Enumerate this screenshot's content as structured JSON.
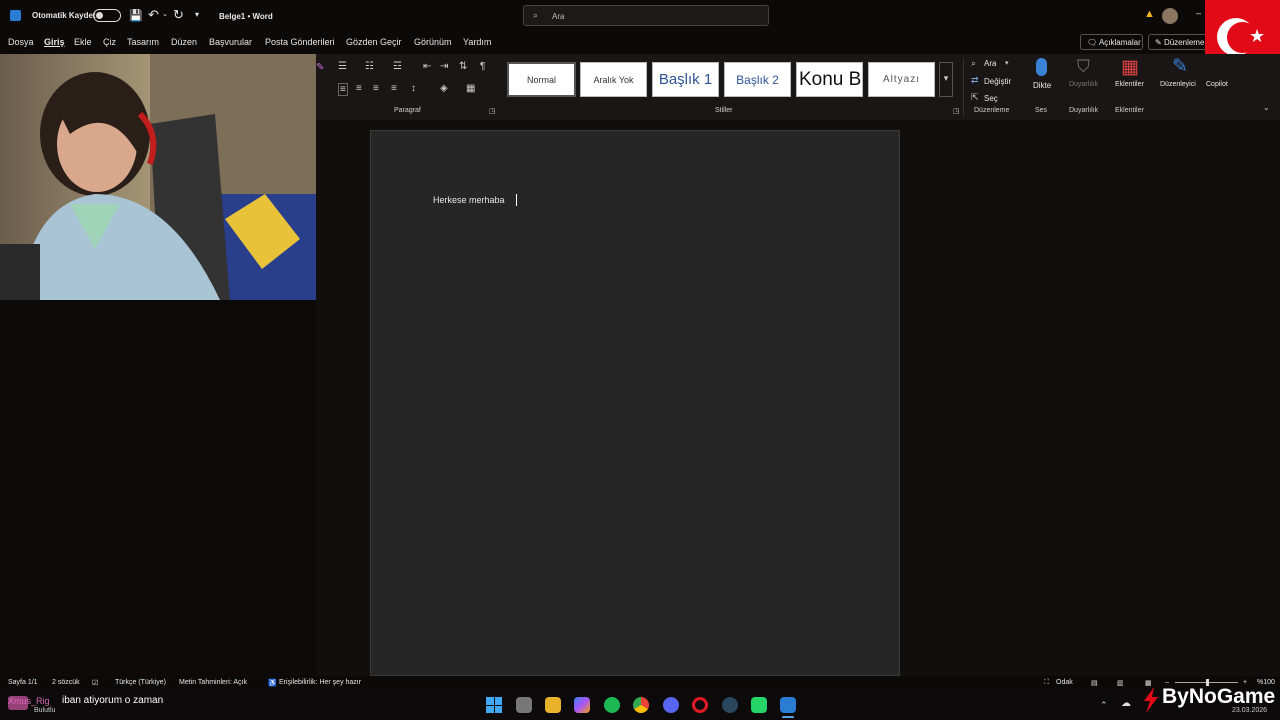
{
  "titlebar": {
    "autosave_label": "Otomatik Kaydet",
    "doc_title": "Belge1 • Word",
    "search_placeholder": "Ara"
  },
  "menu": {
    "items": [
      "Dosya",
      "Giriş",
      "Ekle",
      "Çiz",
      "Tasarım",
      "Düzen",
      "Başvurular",
      "Posta Gönderileri",
      "Gözden Geçir",
      "Görünüm",
      "Yardım"
    ],
    "comments_button": "Açıklamalar",
    "edit_button": "Düzenleme"
  },
  "ribbon": {
    "styles": [
      "Normal",
      "Aralık Yok",
      "Başlık 1",
      "Başlık 2",
      "Konu B",
      "Altyazı"
    ],
    "paragraph_label": "Paragraf",
    "styles_label": "Stiller",
    "find_label": "Ara",
    "replace_label": "Değiştir",
    "select_label": "Seç",
    "editing_label": "Düzenleme",
    "dictate_label": "Dikte",
    "voice_label": "Ses",
    "sensitivity_label": "Duyarlılık",
    "sensitivity_group": "Duyarlılık",
    "addins_label": "Eklentiler",
    "addins_group": "Eklentiler",
    "editor_label": "Düzenleyici",
    "copilot_label": "Copilot"
  },
  "document": {
    "text": "Herkese merhaba"
  },
  "status": {
    "page": "Sayfa 1/1",
    "words": "2 sözcük",
    "language": "Türkçe (Türkiye)",
    "predictions": "Metin Tahminleri: Açık",
    "accessibility": "Erişilebilirlik: Her şey hazır",
    "focus": "Odak",
    "zoom": "%100"
  },
  "taskbar": {
    "chat_user": "Xmus_Rig",
    "chat_sub": "Bulutlu",
    "chat_message": "iban atiyorum o zaman",
    "date": "23.03.2026"
  },
  "watermark": "ByNoGame",
  "colors": {
    "accent_blue": "#2b7cd3",
    "flag_red": "#e30a17"
  }
}
